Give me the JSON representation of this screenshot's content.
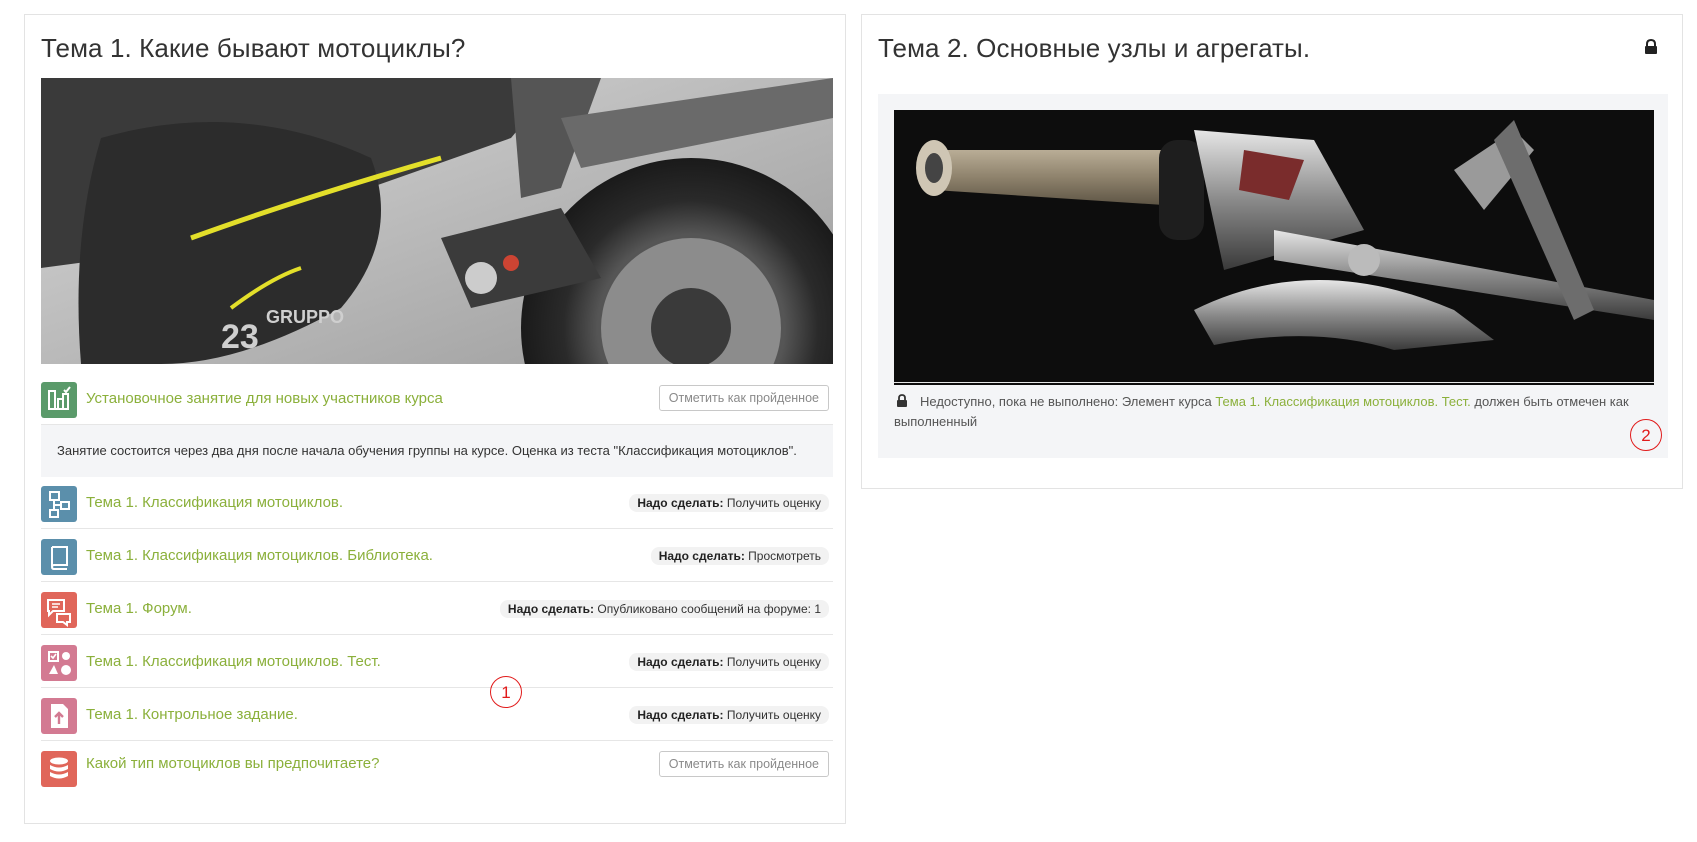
{
  "topic1": {
    "title": "Тема 1. Какие бывают мотоциклы?",
    "activities": [
      {
        "icon": "attendance-icon",
        "color": "#5a9a6a",
        "label": "Установочное занятие для новых участников курса",
        "button": "Отметить как пройденное"
      },
      {
        "icon": "lesson-icon",
        "color": "#5b8fab",
        "label": "Тема 1. Классификация мотоциклов.",
        "todo_label": "Надо сделать:",
        "todo_value": "Получить оценку"
      },
      {
        "icon": "book-icon",
        "color": "#5b8fab",
        "label": "Тема 1. Классификация мотоциклов. Библиотека.",
        "todo_label": "Надо сделать:",
        "todo_value": "Просмотреть"
      },
      {
        "icon": "forum-icon",
        "color": "#e0665a",
        "label": "Тема 1. Форум.",
        "todo_label": "Надо сделать:",
        "todo_value": "Опубликовано сообщений на форуме: 1"
      },
      {
        "icon": "quiz-icon",
        "color": "#d37a92",
        "label": "Тема 1. Классификация мотоциклов. Тест.",
        "todo_label": "Надо сделать:",
        "todo_value": "Получить оценку"
      },
      {
        "icon": "assignment-icon",
        "color": "#d37a92",
        "label": "Тема 1. Контрольное задание.",
        "todo_label": "Надо сделать:",
        "todo_value": "Получить оценку"
      },
      {
        "icon": "database-icon",
        "color": "#e0665a",
        "label": "Какой тип мотоциклов вы предпочитаете?",
        "button": "Отметить как пройденное"
      }
    ],
    "description": "Занятие состоится через два дня после начала обучения группы на курсе. Оценка из теста \"Классификация мотоциклов\"."
  },
  "topic2": {
    "title": "Тема 2. Основные узлы и агрегаты.",
    "restriction_prefix": "Недоступно, пока не выполнено: Элемент курса",
    "restriction_link": "Тема 1. Классификация мотоциклов. Тест.",
    "restriction_suffix": "должен быть отмечен как выполненный"
  },
  "markers": {
    "one": "1",
    "two": "2"
  },
  "colors": {
    "accent": "#8bb03b",
    "marker": "#e11b1b"
  }
}
